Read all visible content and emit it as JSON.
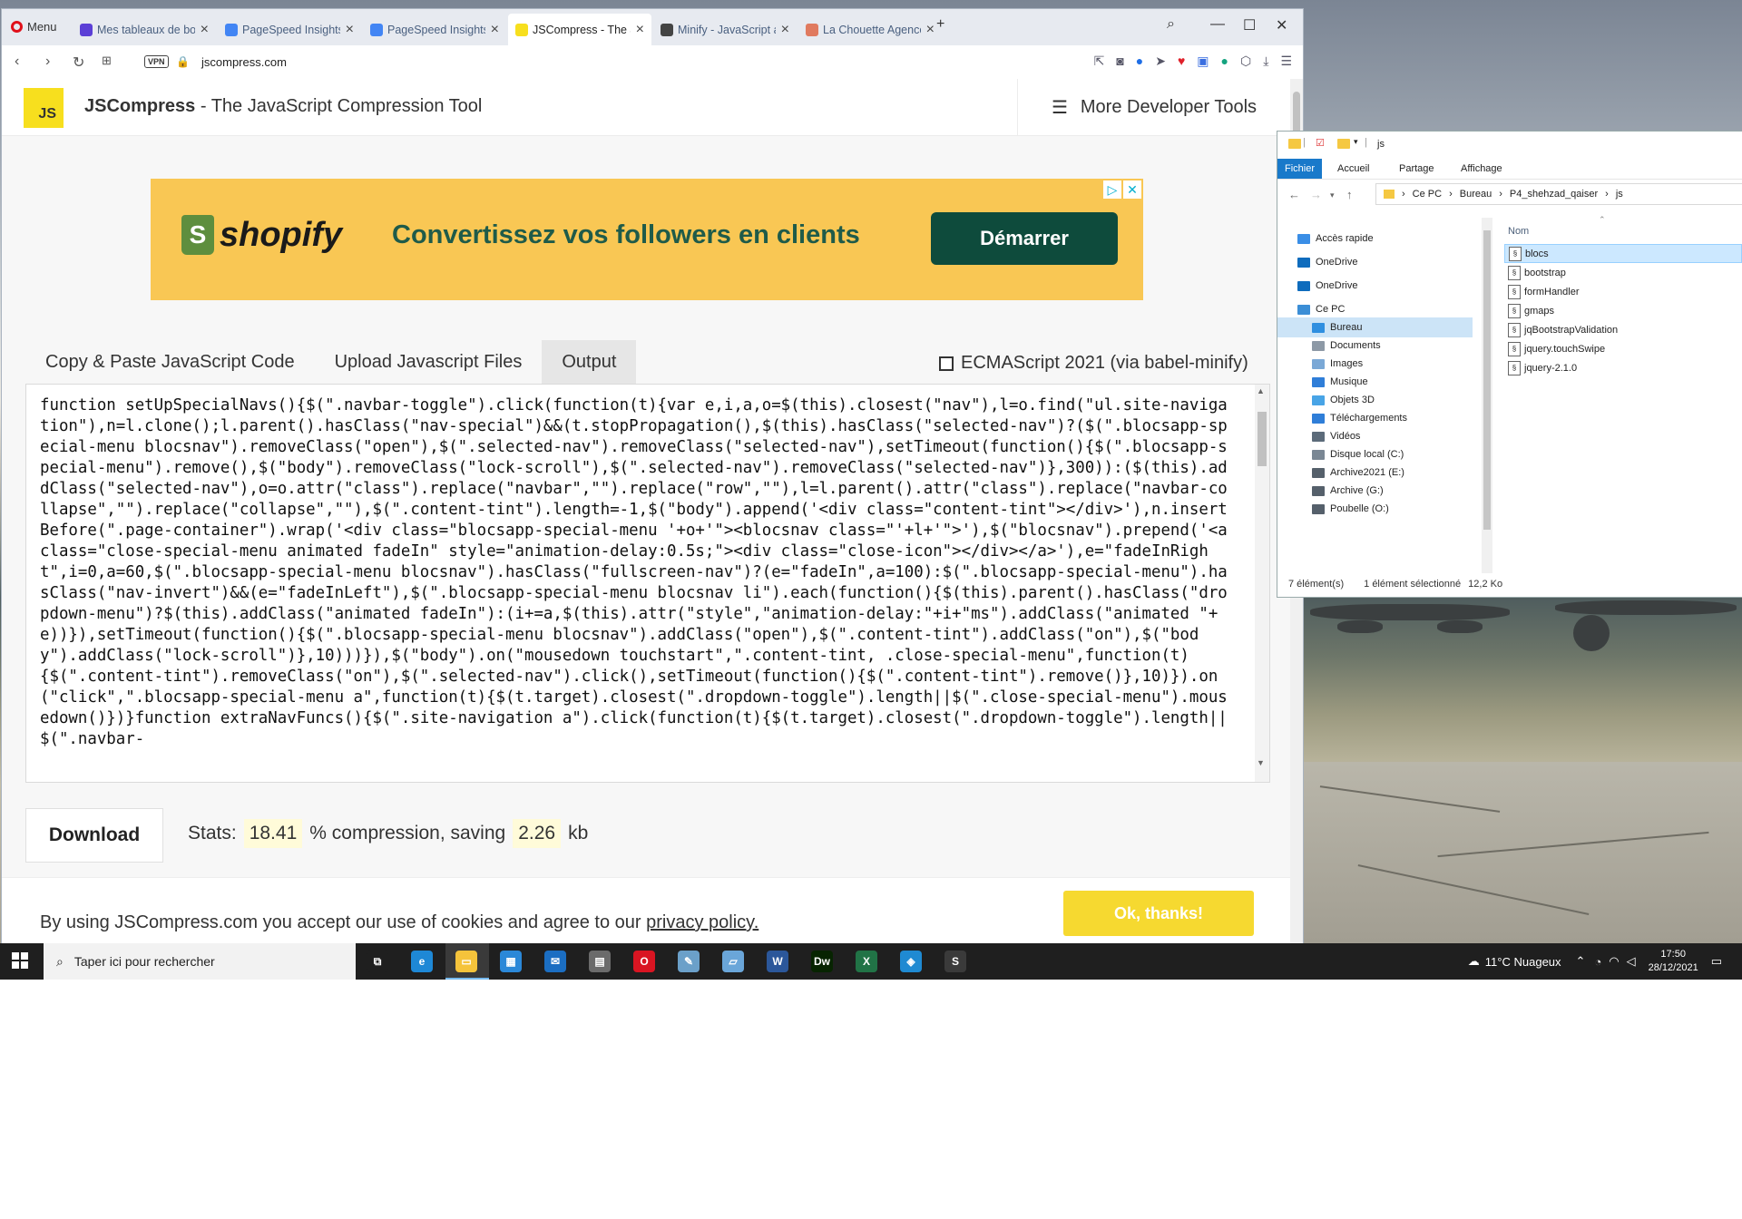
{
  "browser": {
    "menu_label": "Menu",
    "tabs": [
      {
        "title": "Mes tableaux de bord - M",
        "fav_color": "#5b3fd6"
      },
      {
        "title": "PageSpeed Insights",
        "fav_color": "#4285f4"
      },
      {
        "title": "PageSpeed Insights",
        "fav_color": "#4285f4"
      },
      {
        "title": "JSCompress - The JavaScr",
        "fav_color": "#f7df1e"
      },
      {
        "title": "Minify - JavaScript and CS",
        "fav_color": "#444444"
      },
      {
        "title": "La Chouette Agence - Ent",
        "fav_color": "#e07a5f"
      }
    ],
    "vpn_label": "VPN",
    "url": "jscompress.com"
  },
  "site": {
    "logo_text": "JS",
    "brand_name": "JSCompress",
    "brand_tagline": " - The JavaScript Compression Tool",
    "dev_tools_label": "More Developer Tools"
  },
  "ad": {
    "brand": "shopify",
    "tagline": "Convertissez vos followers en clients",
    "cta": "Démarrer"
  },
  "tool": {
    "tabs": [
      "Copy & Paste JavaScript Code",
      "Upload Javascript Files",
      "Output"
    ],
    "active_tab": 2,
    "ecma_label": "ECMAScript 2021 (via babel-minify)",
    "ecma_checked": false,
    "output_code": "function setUpSpecialNavs(){$(\".navbar-toggle\").click(function(t){var e,i,a,o=$(this).closest(\"nav\"),l=o.find(\"ul.site-navigation\"),n=l.clone();l.parent().hasClass(\"nav-special\")&&(t.stopPropagation(),$(this).hasClass(\"selected-nav\")?($(\".blocsapp-special-menu blocsnav\").removeClass(\"open\"),$(\".selected-nav\").removeClass(\"selected-nav\"),setTimeout(function(){$(\".blocsapp-special-menu\").remove(),$(\"body\").removeClass(\"lock-scroll\"),$(\".selected-nav\").removeClass(\"selected-nav\")},300)):($(this).addClass(\"selected-nav\"),o=o.attr(\"class\").replace(\"navbar\",\"\").replace(\"row\",\"\"),l=l.parent().attr(\"class\").replace(\"navbar-collapse\",\"\").replace(\"collapse\",\"\"),$(\".content-tint\").length=-1,$(\"body\").append('<div class=\"content-tint\"></div>'),n.insertBefore(\".page-container\").wrap('<div class=\"blocsapp-special-menu '+o+'\"><blocsnav class=\"'+l+'\">'),$(\"blocsnav\").prepend('<a class=\"close-special-menu animated fadeIn\" style=\"animation-delay:0.5s;\"><div class=\"close-icon\"></div></a>'),e=\"fadeInRight\",i=0,a=60,$(\".blocsapp-special-menu blocsnav\").hasClass(\"fullscreen-nav\")?(e=\"fadeIn\",a=100):$(\".blocsapp-special-menu\").hasClass(\"nav-invert\")&&(e=\"fadeInLeft\"),$(\".blocsapp-special-menu blocsnav li\").each(function(){$(this).parent().hasClass(\"dropdown-menu\")?$(this).addClass(\"animated fadeIn\"):(i+=a,$(this).attr(\"style\",\"animation-delay:\"+i+\"ms\").addClass(\"animated \"+e))}),setTimeout(function(){$(\".blocsapp-special-menu blocsnav\").addClass(\"open\"),$(\".content-tint\").addClass(\"on\"),$(\"body\").addClass(\"lock-scroll\")},10)))}),$(\"body\").on(\"mousedown touchstart\",\".content-tint, .close-special-menu\",function(t){$(\".content-tint\").removeClass(\"on\"),$(\".selected-nav\").click(),setTimeout(function(){$(\".content-tint\").remove()},10)}).on(\"click\",\".blocsapp-special-menu a\",function(t){$(t.target).closest(\".dropdown-toggle\").length||$(\".close-special-menu\").mousedown()})}function extraNavFuncs(){$(\".site-navigation a\").click(function(t){$(t.target).closest(\".dropdown-toggle\").length||$(\".navbar-",
    "download_label": "Download",
    "stats_prefix": "Stats:",
    "compression_pct": "18.41",
    "stats_middle": "% compression, saving",
    "saving_kb": "2.26",
    "stats_unit": "kb"
  },
  "cookie": {
    "text": "By using JSCompress.com you accept our use of cookies and agree to our",
    "link": "privacy policy.",
    "ok": "Ok, thanks!"
  },
  "explorer": {
    "title": "js",
    "ribbon_tabs": [
      "Fichier",
      "Accueil",
      "Partage",
      "Affichage"
    ],
    "path": [
      "Ce PC",
      "Bureau",
      "P4_shehzad_qaiser",
      "js"
    ],
    "nav_items": [
      {
        "label": "Accès rapide",
        "icon": "star-icon",
        "color": "#3a8ee6"
      },
      {
        "label": "OneDrive",
        "icon": "cloud-icon",
        "color": "#0f6cbd"
      },
      {
        "label": "OneDrive",
        "icon": "cloud-icon",
        "color": "#0f6cbd"
      },
      {
        "label": "Ce PC",
        "icon": "pc-icon",
        "color": "#3b8ed6"
      },
      {
        "label": "Bureau",
        "icon": "desktop-icon",
        "color": "#2f8fe0"
      },
      {
        "label": "Documents",
        "icon": "document-icon",
        "color": "#8d99a6"
      },
      {
        "label": "Images",
        "icon": "image-icon",
        "color": "#7aa8d6"
      },
      {
        "label": "Musique",
        "icon": "music-icon",
        "color": "#2f7ed8"
      },
      {
        "label": "Objets 3D",
        "icon": "cube-icon",
        "color": "#48a4e6"
      },
      {
        "label": "Téléchargements",
        "icon": "download-icon",
        "color": "#2f7ed8"
      },
      {
        "label": "Vidéos",
        "icon": "video-icon",
        "color": "#5c6b7a"
      },
      {
        "label": "Disque local (C:)",
        "icon": "drive-icon",
        "color": "#7a8794"
      },
      {
        "label": "Archive2021 (E:)",
        "icon": "drive-icon",
        "color": "#55606b"
      },
      {
        "label": "Archive (G:)",
        "icon": "drive-icon",
        "color": "#55606b"
      },
      {
        "label": "Poubelle (O:)",
        "icon": "drive-icon",
        "color": "#55606b"
      }
    ],
    "selected_nav": 4,
    "column_header": "Nom",
    "files": [
      "blocs",
      "bootstrap",
      "formHandler",
      "gmaps",
      "jqBootstrapValidation",
      "jquery.touchSwipe",
      "jquery-2.1.0"
    ],
    "selected_file": 0,
    "status_count": "7 élément(s)",
    "status_selected": "1 élément sélectionné",
    "status_size": "12,2 Ko"
  },
  "taskbar": {
    "search_placeholder": "Taper ici pour rechercher",
    "apps": [
      {
        "name": "task-view-icon",
        "color": "#1f1f1f",
        "label": "⧉"
      },
      {
        "name": "edge-icon",
        "color": "#1e88d6",
        "label": "e"
      },
      {
        "name": "file-explorer-icon",
        "color": "#f5c33b",
        "label": "▭"
      },
      {
        "name": "store-icon",
        "color": "#2b88d8",
        "label": "▦"
      },
      {
        "name": "mail-icon",
        "color": "#1b6ec2",
        "label": "✉"
      },
      {
        "name": "calculator-icon",
        "color": "#6b6b6b",
        "label": "▤"
      },
      {
        "name": "opera-icon",
        "color": "#d91522",
        "label": "O"
      },
      {
        "name": "paint-icon",
        "color": "#6ba0c9",
        "label": "✎"
      },
      {
        "name": "notepad-icon",
        "color": "#6aa6d9",
        "label": "▱"
      },
      {
        "name": "word-icon",
        "color": "#2b579a",
        "label": "W"
      },
      {
        "name": "dreamweaver-icon",
        "color": "#072401",
        "label": "Dw"
      },
      {
        "name": "excel-icon",
        "color": "#217346",
        "label": "X"
      },
      {
        "name": "vscode-icon",
        "color": "#1f8ad2",
        "label": "◈"
      },
      {
        "name": "sublime-icon",
        "color": "#3a3a3a",
        "label": "S"
      }
    ],
    "weather": "11°C  Nuageux",
    "time": "17:50",
    "date": "28/12/2021"
  }
}
